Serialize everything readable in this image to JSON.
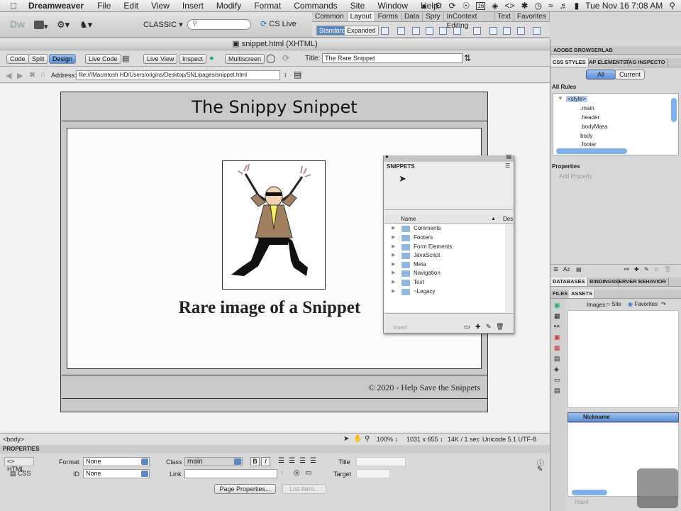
{
  "menubar": {
    "app_name": "Dreamweaver",
    "items": [
      "File",
      "Edit",
      "View",
      "Insert",
      "Modify",
      "Format",
      "Commands",
      "Site",
      "Window",
      "Help"
    ],
    "clock": "Tue Nov 16  7:08 AM",
    "calendar_badge": "16"
  },
  "app_toolbar": {
    "logo": "Dw",
    "workspace": "CLASSIC",
    "cs_live": "CS Live"
  },
  "insert_panel": {
    "tabs": [
      "Common",
      "Layout",
      "Forms",
      "Data",
      "Spry",
      "InContext Editing",
      "Text",
      "Favorites"
    ],
    "active_tab": "Layout",
    "modes": [
      "Standard",
      "Expanded"
    ]
  },
  "document": {
    "window_title": "snippet.html (XHTML)",
    "view_buttons": [
      "Code",
      "Split",
      "Design"
    ],
    "active_view": "Design",
    "live_code": "Live Code",
    "live_view": "Live View",
    "inspect": "Inspect",
    "multiscreen": "Multiscreen",
    "title_label": "Title:",
    "title_value": "The Rare Snippet",
    "address_label": "Address:",
    "address_value": "file:///Macintosh HD/Users/origins/Desktop/SNL/pages/snippet.html"
  },
  "page": {
    "header": "The Snippy Snippet",
    "caption": "Rare image of a Snippet",
    "footer": "© 2020 - Help Save the Snippets"
  },
  "snippets": {
    "tab": "SNIPPETS",
    "col_name": "Name",
    "col_desc": "Des",
    "items": [
      "Comments",
      "Footers",
      "Form Elements",
      "JavaScript",
      "Meta",
      "Navigation",
      "Text",
      "~Legacy"
    ],
    "insert_button": "Insert"
  },
  "status": {
    "tag": "<body>",
    "zoom": "100%",
    "dims": "1031 x 655",
    "size": "14K / 1 sec",
    "encoding": "Unicode 5.1 UTF-8"
  },
  "properties": {
    "header": "PROPERTIES",
    "html_tab": "HTML",
    "css_tab": "CSS",
    "format_label": "Format",
    "format_value": "None",
    "id_label": "ID",
    "id_value": "None",
    "class_label": "Class",
    "class_value": "main",
    "link_label": "Link",
    "title_label": "Title",
    "target_label": "Target",
    "bold": "B",
    "italic": "I",
    "page_properties": "Page Properties...",
    "list_item": "List Item..."
  },
  "right_panel": {
    "browserlab": "ADOBE BROWSERLAB",
    "tabs": [
      "CSS STYLES",
      "AP ELEMENTS",
      "TAG INSPECTO"
    ],
    "all_btn": "All",
    "current_btn": "Current",
    "all_rules": "All Rules",
    "rules": [
      "<style>",
      ".main",
      ".header",
      ".bodyMass",
      "body",
      ".footer"
    ],
    "properties_label": "Properties",
    "add_property": "Add Property",
    "db_tabs": [
      "DATABASES",
      "BINDINGS",
      "SERVER BEHAVIOR"
    ],
    "files_tabs": [
      "FILES",
      "ASSETS"
    ],
    "images_label": "Images:",
    "site_opt": "Site",
    "favorites_opt": "Favorites",
    "nickname": "Nickname",
    "insert": "Insert"
  }
}
